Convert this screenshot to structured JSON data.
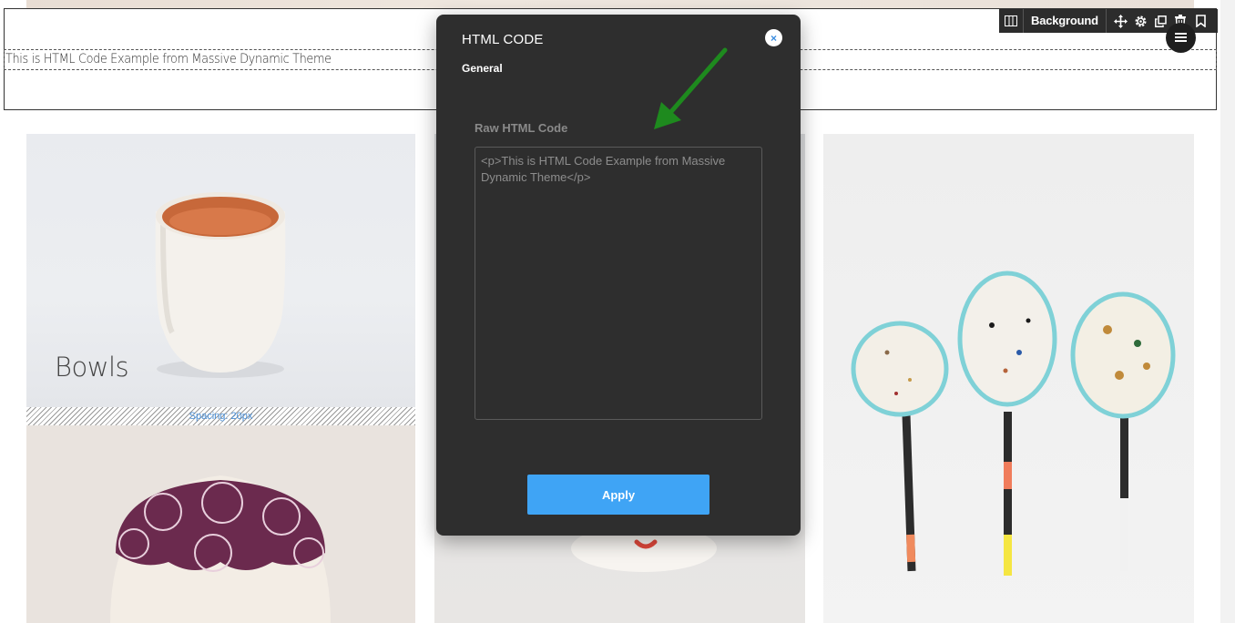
{
  "row": {
    "html_text": "This is HTML Code Example from Massive Dynamic Theme",
    "toolbar": {
      "layout_icon": "columns-icon",
      "background_label": "Background",
      "icons": [
        "move-icon",
        "gear-icon",
        "duplicate-icon",
        "trash-icon",
        "bookmark-icon"
      ]
    },
    "menu_icon": "hamburger-icon"
  },
  "gallery": {
    "bowls_label": "Bowls",
    "spacing_label": "Spacing: 20px"
  },
  "dialog": {
    "title": "HTML CODE",
    "close_glyph": "×",
    "tab_label": "General",
    "field_label": "Raw HTML Code",
    "textarea_value": "<p>This is HTML Code Example from Massive Dynamic Theme</p>",
    "apply_label": "Apply"
  },
  "colors": {
    "dialog_bg": "#2e2e2e",
    "apply_button": "#3fa4f5",
    "close_icon": "#3a8de0",
    "annotation_arrow": "#1e8a1e",
    "spacing_label": "#4a90d9"
  }
}
